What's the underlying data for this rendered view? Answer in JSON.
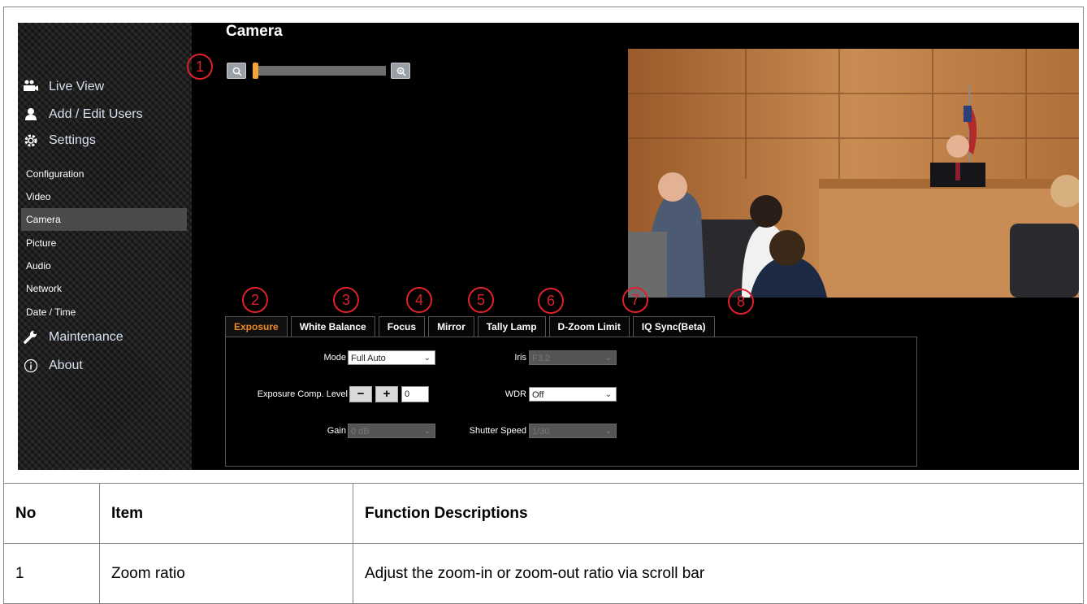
{
  "sidebar": {
    "main_items": [
      {
        "label": "Live View",
        "icon": "camera-people-icon"
      },
      {
        "label": "Add / Edit Users",
        "icon": "user-icon"
      },
      {
        "label": "Settings",
        "icon": "gear-icon"
      },
      {
        "label": "Maintenance",
        "icon": "wrench-icon"
      },
      {
        "label": "About",
        "icon": "info-icon"
      }
    ],
    "sub_items": [
      "Configuration",
      "Video",
      "Camera",
      "Picture",
      "Audio",
      "Network",
      "Date / Time"
    ],
    "active_sub": "Camera"
  },
  "page": {
    "title": "Camera"
  },
  "zoom": {
    "level": 0.0
  },
  "callouts": [
    "1",
    "2",
    "3",
    "4",
    "5",
    "6",
    "7",
    "8"
  ],
  "tabs": [
    "Exposure",
    "White Balance",
    "Focus",
    "Mirror",
    "Tally Lamp",
    "D-Zoom Limit",
    "IQ Sync(Beta)"
  ],
  "active_tab": "Exposure",
  "exposure": {
    "mode_label": "Mode",
    "mode_value": "Full Auto",
    "iris_label": "Iris",
    "iris_value": "F3.2",
    "comp_label": "Exposure Comp. Level",
    "comp_minus": "−",
    "comp_plus": "+",
    "comp_value": "0",
    "wdr_label": "WDR",
    "wdr_value": "Off",
    "gain_label": "Gain",
    "gain_value": "0 dB",
    "shutter_label": "Shutter Speed",
    "shutter_value": "1/30"
  },
  "table": {
    "headers": [
      "No",
      "Item",
      "Function Descriptions"
    ],
    "rows": [
      [
        "1",
        "Zoom ratio",
        "Adjust the zoom-in or zoom-out ratio via scroll bar"
      ]
    ]
  },
  "colors": {
    "accent": "#f08a22",
    "callout": "#e0202a",
    "background": "#000000",
    "link": "#d6e2f0"
  }
}
